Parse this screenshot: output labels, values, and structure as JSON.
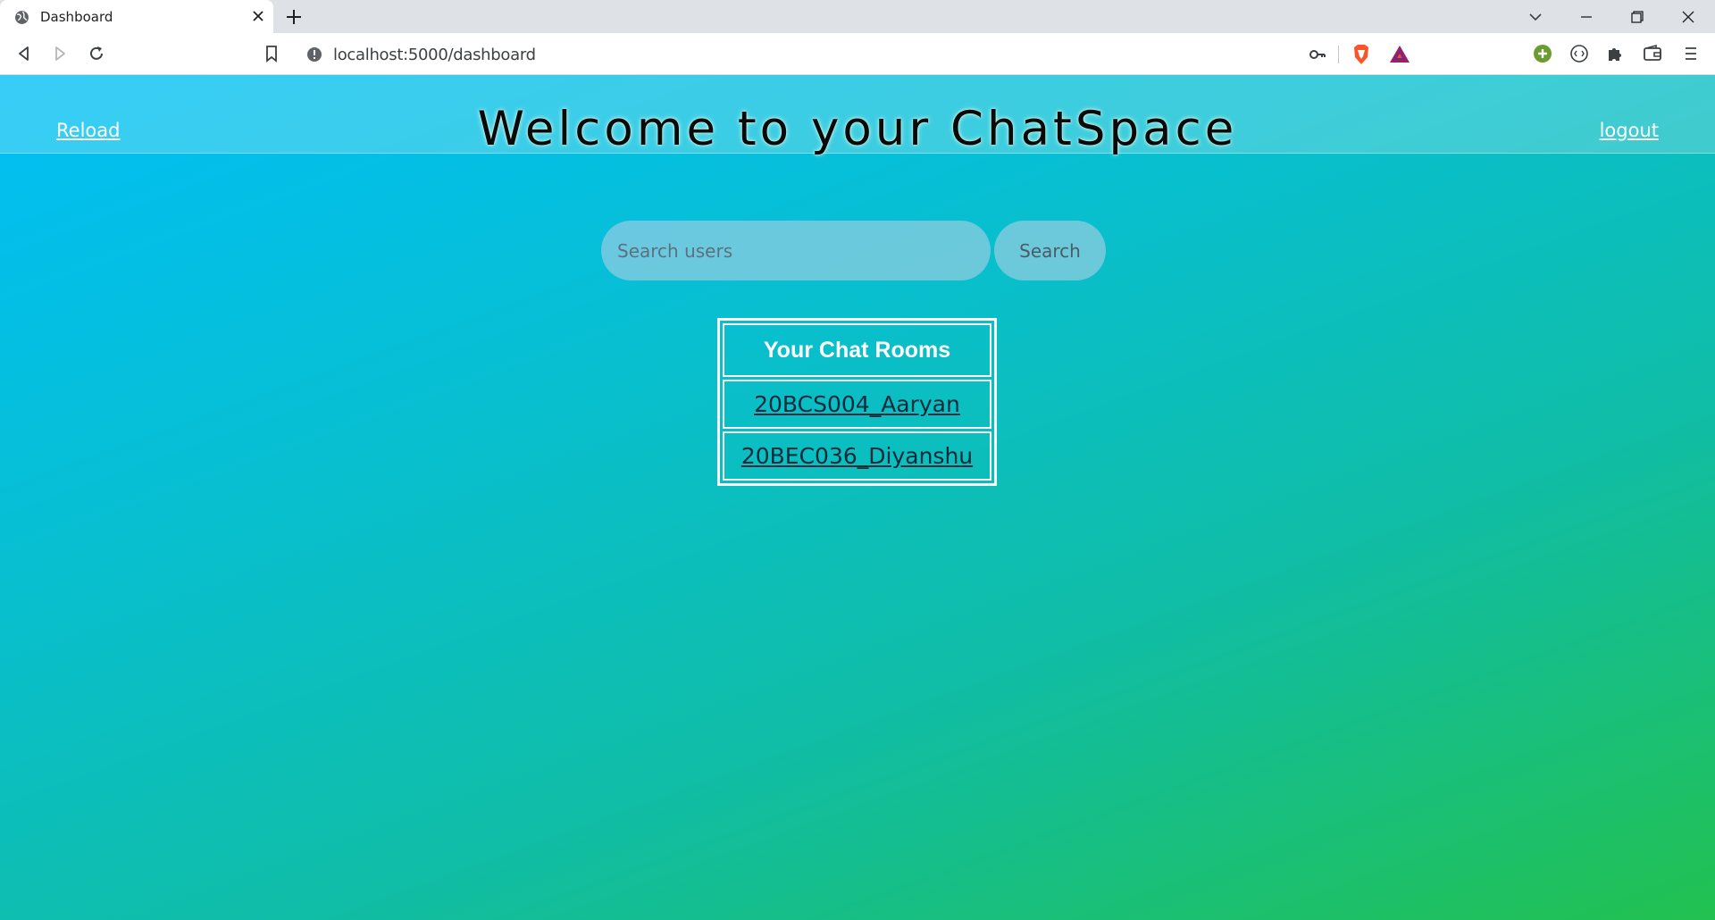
{
  "browser": {
    "tab_title": "Dashboard",
    "url": "localhost:5000/dashboard"
  },
  "header": {
    "reload_label": "Reload",
    "title": "Welcome to your ChatSpace",
    "logout_label": "logout"
  },
  "search": {
    "placeholder": "Search users",
    "value": "",
    "button_label": "Search"
  },
  "rooms": {
    "heading": "Your Chat Rooms",
    "items": [
      "20BCS004_Aaryan",
      "20BEC036_Diyanshu"
    ]
  },
  "colors": {
    "gradient_start": "#00bff6",
    "gradient_end": "#22c150",
    "header_text": "#ffffff"
  }
}
